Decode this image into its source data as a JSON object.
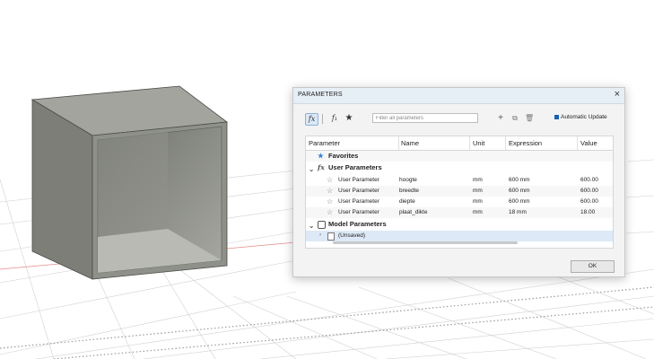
{
  "dialog": {
    "title": "PARAMETERS",
    "close": "×"
  },
  "toolbar": {
    "fx_icon": "fx",
    "f1_icon": "f₁",
    "favorites_icon": "★",
    "search_placeholder": "Filter all parameters",
    "add_icon": "+",
    "copy_icon": "⧉",
    "delete_icon": "🗑",
    "auto_update_label": "Automatic Update"
  },
  "table": {
    "columns": [
      "Parameter",
      "Name",
      "Unit",
      "Expression",
      "Value"
    ],
    "groups": {
      "favorites": "Favorites",
      "user": "User Parameters",
      "model": "Model Parameters",
      "unsaved": "(Unsaved)"
    },
    "rows": [
      {
        "parameter": "User Parameter",
        "name": "hoogte",
        "unit": "mm",
        "expression": "600 mm",
        "value": "600.00"
      },
      {
        "parameter": "User Parameter",
        "name": "breedte",
        "unit": "mm",
        "expression": "600 mm",
        "value": "600.00"
      },
      {
        "parameter": "User Parameter",
        "name": "diepte",
        "unit": "mm",
        "expression": "600 mm",
        "value": "600.00"
      },
      {
        "parameter": "User Parameter",
        "name": "plaat_dikte",
        "unit": "mm",
        "expression": "18 mm",
        "value": "18.00"
      }
    ]
  },
  "footer": {
    "ok_label": "OK"
  },
  "colors": {
    "accent": "#1a60b5",
    "model_gray": "#8a8b84",
    "grid_line": "#c8c8c8",
    "axis_red": "#e07070"
  }
}
